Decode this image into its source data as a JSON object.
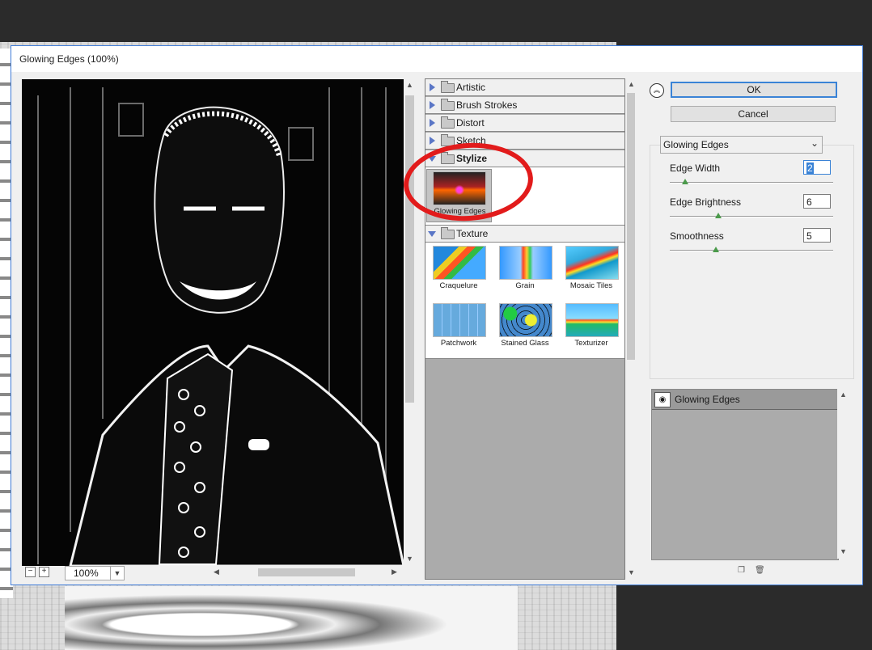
{
  "window": {
    "title": "Glowing Edges (100%)"
  },
  "preview": {
    "zoom": "100%",
    "zoom_out": "−",
    "zoom_in": "+"
  },
  "filters": {
    "categories": [
      {
        "label": "Artistic",
        "expanded": false
      },
      {
        "label": "Brush Strokes",
        "expanded": false
      },
      {
        "label": "Distort",
        "expanded": false
      },
      {
        "label": "Sketch",
        "expanded": false
      },
      {
        "label": "Stylize",
        "expanded": true
      },
      {
        "label": "Texture",
        "expanded": true
      }
    ],
    "stylize_items": [
      {
        "label": "Glowing Edges",
        "selected": true
      }
    ],
    "texture_items": [
      {
        "label": "Craquelure"
      },
      {
        "label": "Grain"
      },
      {
        "label": "Mosaic Tiles"
      },
      {
        "label": "Patchwork"
      },
      {
        "label": "Stained Glass"
      },
      {
        "label": "Texturizer"
      }
    ]
  },
  "buttons": {
    "ok": "OK",
    "cancel": "Cancel",
    "collapse": "︽"
  },
  "settings": {
    "filter_select": "Glowing Edges",
    "params": [
      {
        "label": "Edge Width",
        "value": "2"
      },
      {
        "label": "Edge Brightness",
        "value": "6"
      },
      {
        "label": "Smoothness",
        "value": "5"
      }
    ]
  },
  "layers": {
    "items": [
      {
        "label": "Glowing Edges"
      }
    ]
  },
  "colors": {
    "accent": "#3a83d6",
    "annotation": "#e21b1b"
  }
}
